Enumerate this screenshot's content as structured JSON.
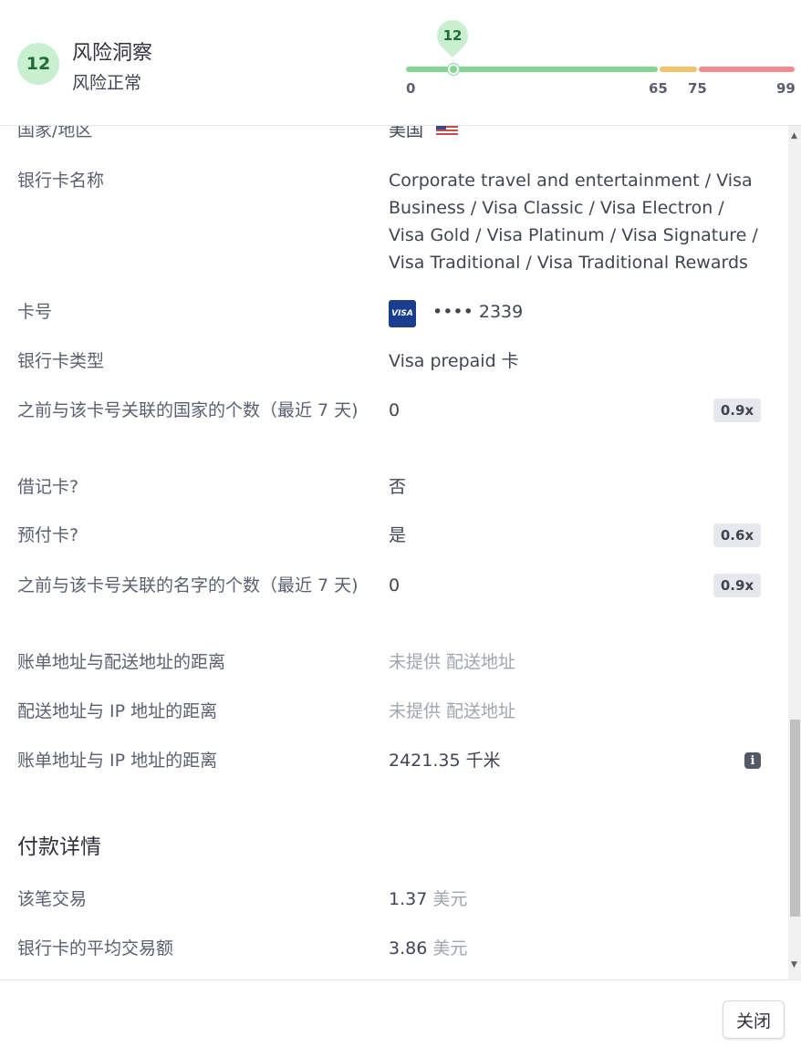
{
  "header": {
    "score": "12",
    "title": "风险洞察",
    "status": "风险正常",
    "gauge": {
      "value": 12,
      "marker_label": "12",
      "ticks": [
        "0",
        "65",
        "75",
        "99"
      ],
      "colors": {
        "normal": "#84d693",
        "elevated": "#f0c36c",
        "highest": "#f28b8b"
      }
    }
  },
  "details": {
    "country": {
      "label": "国家/地区",
      "value": "美国",
      "flag": "us-flag-icon"
    },
    "bank_card_name": {
      "label": "银行卡名称",
      "value": "Corporate travel and entertainment / Visa Business / Visa Classic / Visa Electron / Visa Gold / Visa Platinum / Visa Signature / Visa Traditional / Visa Traditional Rewards"
    },
    "card_number": {
      "label": "卡号",
      "brand": "VISA",
      "value": "•••• 2339"
    },
    "card_type": {
      "label": "银行卡类型",
      "value": "Visa prepaid 卡"
    },
    "countries_linked": {
      "label": "之前与该卡号关联的国家的个数（最近 7 天)",
      "value": "0",
      "badge": "0.9x"
    },
    "debit": {
      "label": "借记卡?",
      "value": "否"
    },
    "prepaid": {
      "label": "预付卡?",
      "value": "是",
      "badge": "0.6x"
    },
    "names_linked": {
      "label": "之前与该卡号关联的名字的个数（最近 7 天)",
      "value": "0",
      "badge": "0.9x"
    },
    "billing_shipping_distance": {
      "label": "账单地址与配送地址的距离",
      "value": "未提供 配送地址"
    },
    "shipping_ip_distance": {
      "label": "配送地址与 IP 地址的距离",
      "value": "未提供 配送地址"
    },
    "billing_ip_distance": {
      "label": "账单地址与 IP 地址的距离",
      "value": "2421.35 千米"
    }
  },
  "payment": {
    "section_title": "付款详情",
    "this_transaction": {
      "label": "该笔交易",
      "amount": "1.37",
      "currency": "美元"
    },
    "card_average": {
      "label": "银行卡的平均交易额",
      "amount": "3.86",
      "currency": "美元"
    }
  },
  "footer": {
    "close_label": "关闭"
  }
}
